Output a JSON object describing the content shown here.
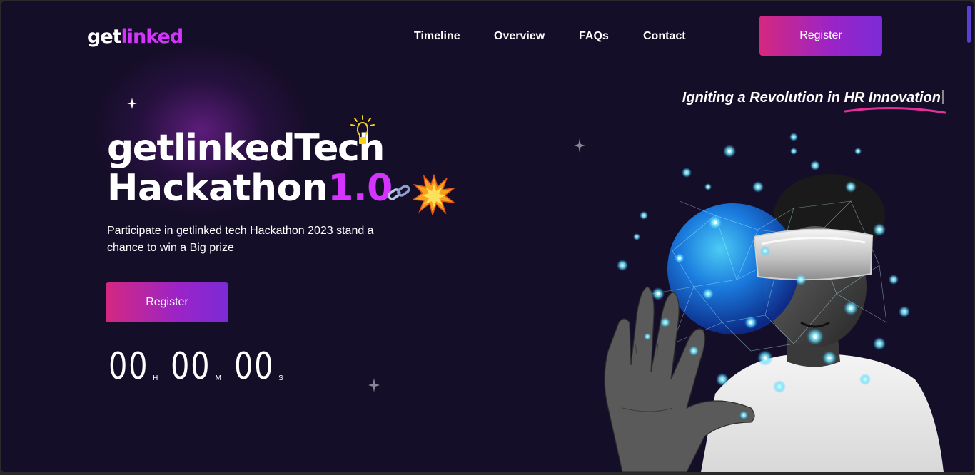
{
  "brand": {
    "logo_main": "get",
    "logo_accent": "linked"
  },
  "nav": {
    "items": [
      {
        "label": "Timeline"
      },
      {
        "label": "Overview"
      },
      {
        "label": "FAQs"
      },
      {
        "label": "Contact"
      }
    ],
    "register_label": "Register"
  },
  "hero": {
    "tagline": "Igniting a Revolution in HR Innovation",
    "title_line1": "getlinkedTech",
    "title_line2": "Hackathon",
    "title_version": "1.0",
    "description": "Participate in getlinked tech Hackathon 2023 stand a chance to win a Big prize",
    "register_label": "Register"
  },
  "countdown": {
    "hours": "00",
    "hours_unit": "H",
    "minutes": "00",
    "minutes_unit": "M",
    "seconds": "00",
    "seconds_unit": "S"
  },
  "colors": {
    "background": "#150e28",
    "accent": "#d434fe",
    "button_gradient_start": "#d4287f",
    "button_gradient_end": "#7b2bd6"
  },
  "icons": [
    "light-bulb-icon",
    "chain-link-icon",
    "explosion-icon",
    "sparkle-star-icon"
  ]
}
